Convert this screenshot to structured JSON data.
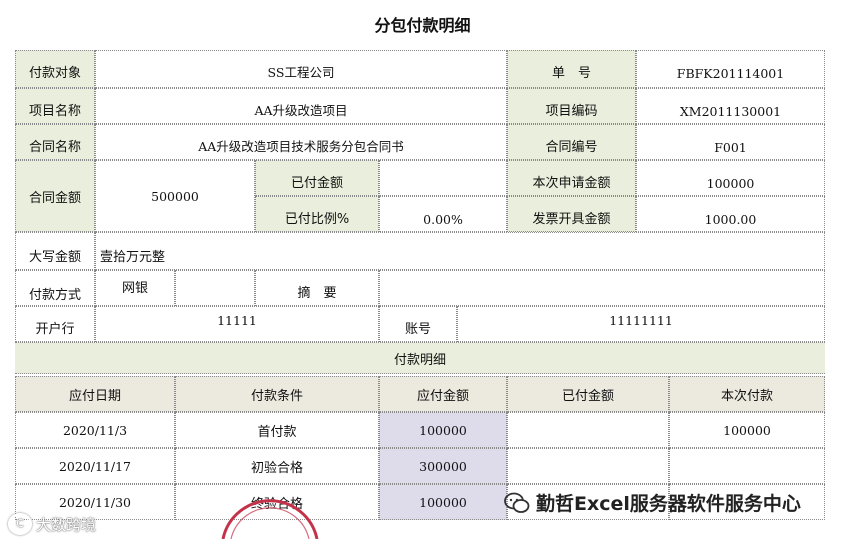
{
  "title": "分包付款明细",
  "header": {
    "payee_label": "付款对象",
    "payee_value": "SS工程公司",
    "doc_no_label": "单　号",
    "doc_no_value": "FBFK201114001",
    "project_name_label": "项目名称",
    "project_name_value": "AA升级改造项目",
    "project_code_label": "项目编码",
    "project_code_value": "XM2011130001",
    "contract_name_label": "合同名称",
    "contract_name_value": "AA升级改造项目技术服务分包合同书",
    "contract_no_label": "合同编号",
    "contract_no_value": "F001",
    "contract_amount_label": "合同金额",
    "contract_amount_value": "500000",
    "paid_amount_label": "已付金额",
    "paid_amount_value": "",
    "request_amount_label": "本次申请金额",
    "request_amount_value": "100000",
    "paid_ratio_label": "已付比例%",
    "paid_ratio_value": "0.00%",
    "invoice_amount_label": "发票开具金额",
    "invoice_amount_value": "1000.00",
    "amount_words_label": "大写金额",
    "amount_words_value": "壹拾万元整",
    "pay_method_label": "付款方式",
    "pay_method_value": "网银",
    "summary_label": "摘　要",
    "summary_value": "",
    "bank_label": "开户行",
    "bank_value": "11111",
    "account_label": "账号",
    "account_value": "11111111"
  },
  "detail": {
    "section_title": "付款明细",
    "columns": [
      "应付日期",
      "付款条件",
      "应付金额",
      "已付金额",
      "本次付款"
    ],
    "rows": [
      {
        "date": "2020/11/3",
        "condition": "首付款",
        "due": "100000",
        "paid": "",
        "current": "100000"
      },
      {
        "date": "2020/11/17",
        "condition": "初验合格",
        "due": "300000",
        "paid": "",
        "current": ""
      },
      {
        "date": "2020/11/30",
        "condition": "终验合格",
        "due": "100000",
        "paid": "",
        "current": ""
      }
    ]
  },
  "watermarks": {
    "left": "大数跨境",
    "right": "勤哲Excel服务器软件服务中心"
  },
  "colors": {
    "label_bg": "#e9efdc",
    "header_bg": "#ece9df",
    "amount_bg": "#dedbeb"
  }
}
